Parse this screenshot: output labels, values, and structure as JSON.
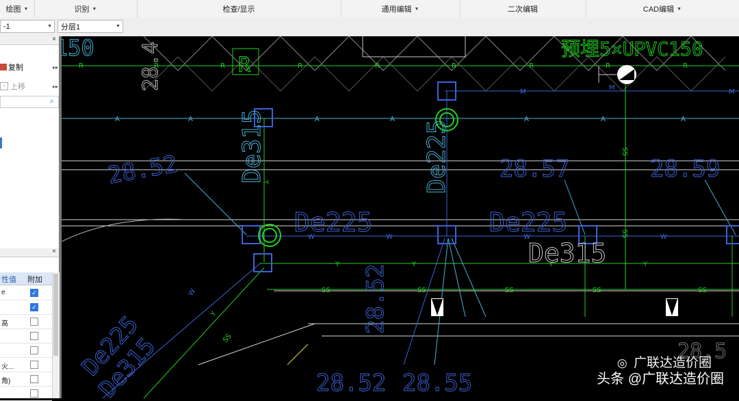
{
  "menubar": {
    "groups": [
      {
        "label": "绘图",
        "has_dropdown": true
      },
      {
        "label": "识别",
        "has_dropdown": true
      },
      {
        "label": "检查/显示",
        "has_dropdown": false
      },
      {
        "label": "通用编辑",
        "has_dropdown": true
      },
      {
        "label": "二次编辑",
        "has_dropdown": false
      },
      {
        "label": "CAD编辑",
        "has_dropdown": true
      }
    ]
  },
  "toolbar": {
    "floor_combo": "-1",
    "layer_combo": "分层1"
  },
  "left_panel": {
    "copy_label": "复制",
    "move_up_label": "上移",
    "props_header_value": "性值",
    "props_header_extra": "附加",
    "props_rows": [
      {
        "value": "e",
        "checked": true
      },
      {
        "value": "",
        "checked": true
      },
      {
        "value": "高",
        "checked": false
      },
      {
        "value": "",
        "checked": false
      },
      {
        "value": "",
        "checked": false
      },
      {
        "value": "火...",
        "checked": false
      },
      {
        "value": "角)",
        "checked": false
      },
      {
        "value": "",
        "checked": false
      }
    ]
  },
  "cad": {
    "text_labels": [
      "150",
      "28.4",
      "R",
      "预埋5×UPVC150",
      "De315",
      "De225",
      "28.52",
      "28.57",
      "28.59",
      "De225",
      "De225",
      "De315",
      "De225",
      "De315",
      "28.52",
      "28.52",
      "28.55",
      "28.5"
    ],
    "line_codes": [
      "R",
      "R",
      "R",
      "R",
      "R",
      "R",
      "R",
      "R",
      "R",
      "R",
      "M",
      "M",
      "M",
      "M",
      "A",
      "A",
      "A",
      "A",
      "A",
      "A",
      "A",
      "A",
      "A",
      "A",
      "SS",
      "SS",
      "W",
      "W",
      "W",
      "W",
      "W",
      "W",
      "W",
      "Y",
      "Y",
      "Y",
      "Y",
      "Y",
      "Y",
      "Y",
      "Y",
      "SS",
      "SS",
      "SS",
      "SS",
      "SS",
      "SS",
      "SS",
      "W",
      "Y",
      "SS",
      "Y",
      "Y"
    ],
    "colors": {
      "green": "#22d322",
      "blue": "#3b63d6",
      "cyan": "#4ab2d8",
      "white": "#d8d8d8",
      "yellow": "#e7e030"
    }
  },
  "watermark": {
    "line1": "广联达造价圈",
    "line2_prefix": "头条",
    "line2": "@广联达造价圈"
  }
}
